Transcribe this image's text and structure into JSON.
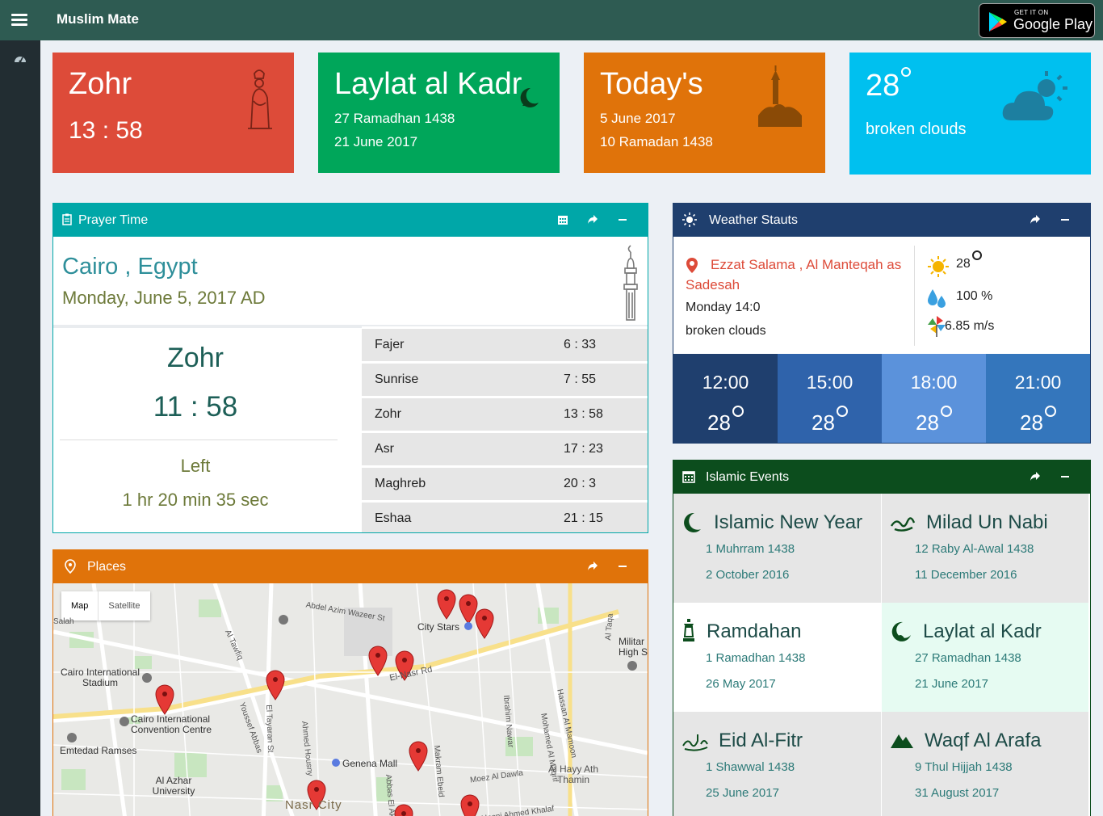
{
  "app": {
    "brand": "Muslim Mate",
    "store_small": "GET IT ON",
    "store_big": "Google Play"
  },
  "colors": {
    "topbar": "#2e5b52",
    "sidebar": "#222d32",
    "red": "#dd4b39",
    "green": "#00a65a",
    "orange": "#e0730a",
    "aqua": "#00c0ef",
    "teal": "#00a7a8",
    "navy": "#1f3f6e",
    "darkgreen": "#0c4d1d"
  },
  "cards": {
    "zohr": {
      "title": "Zohr",
      "time": "13 : 58"
    },
    "kadr": {
      "title": "Laylat al Kadr",
      "line1": "27 Ramadhan 1438",
      "line2": "21 June 2017"
    },
    "today": {
      "title": "Today's",
      "line1": "5 June 2017",
      "line2": "10 Ramadan 1438"
    },
    "weather": {
      "temp": "28",
      "desc": "broken clouds"
    }
  },
  "prayer": {
    "header": "Prayer Time",
    "city": "Cairo , Egypt",
    "date": "Monday, June 5, 2017 AD",
    "current_name": "Zohr",
    "current_time": "11 : 58",
    "left_label": "Left",
    "left_value": "1 hr 20 min 35 sec",
    "rows": [
      {
        "name": "Fajer",
        "time": "6 : 33"
      },
      {
        "name": "Sunrise",
        "time": "7 : 55"
      },
      {
        "name": "Zohr",
        "time": "13 : 58"
      },
      {
        "name": "Asr",
        "time": "17 : 23"
      },
      {
        "name": "Maghreb",
        "time": "20 : 3"
      },
      {
        "name": "Eshaa",
        "time": "21 : 15"
      }
    ]
  },
  "places": {
    "header": "Places",
    "map_btn": "Map",
    "sat_btn": "Satellite",
    "labels": [
      "Cairo International Stadium",
      "Cairo International Convention Centre",
      "Emtedad Ramses",
      "Al Azhar University",
      "City Stars",
      "Abdel Azim Wazeer St",
      "El-Nasr Rd",
      "Genena Mall",
      "Nasr City",
      "Moez Al Dawla",
      "Al Hayy Ath Thamin",
      "Militar High S",
      "Makram Ebeid",
      "Abbas El Akkad",
      "Hosni Ahmed Khalaf",
      "El Tayaran St",
      "Youssef Abbas",
      "Ahmed Housny",
      "Ibrahim Nawar",
      "Hassan Al Mamoon",
      "Al Tawfiq",
      "Al Taqa",
      "Salah",
      "Mohamed Al Maqrif"
    ]
  },
  "weather": {
    "header": "Weather Stauts",
    "location": "Ezzat Salama , Al Manteqah as Sadesah",
    "day": "Monday 14:0",
    "desc": "broken clouds",
    "temp": "28",
    "humidity": "100 %",
    "wind": "6.85 m/s",
    "hours": [
      {
        "time": "12:00",
        "temp": "28",
        "color": "#1f3f6e"
      },
      {
        "time": "15:00",
        "temp": "28",
        "color": "#2f63ab"
      },
      {
        "time": "18:00",
        "temp": "28",
        "color": "#5b92db"
      },
      {
        "time": "21:00",
        "temp": "28",
        "color": "#3476bc"
      }
    ]
  },
  "events": {
    "header": "Islamic Events",
    "items": [
      {
        "name": "Islamic New Year",
        "hijri": "1 Muhrram 1438",
        "greg": "2 October 2016"
      },
      {
        "name": "Milad Un Nabi",
        "hijri": "12 Raby Al-Awal 1438",
        "greg": "11 December 2016"
      },
      {
        "name": "Ramdahan",
        "hijri": "1 Ramadhan 1438",
        "greg": "26 May 2017"
      },
      {
        "name": "Laylat al Kadr",
        "hijri": "27 Ramadhan 1438",
        "greg": "21 June 2017"
      },
      {
        "name": "Eid Al-Fitr",
        "hijri": "1 Shawwal 1438",
        "greg": "25 June 2017"
      },
      {
        "name": "Waqf Al Arafa",
        "hijri": "9 Thul Hijjah 1438",
        "greg": "31 August 2017"
      }
    ]
  }
}
